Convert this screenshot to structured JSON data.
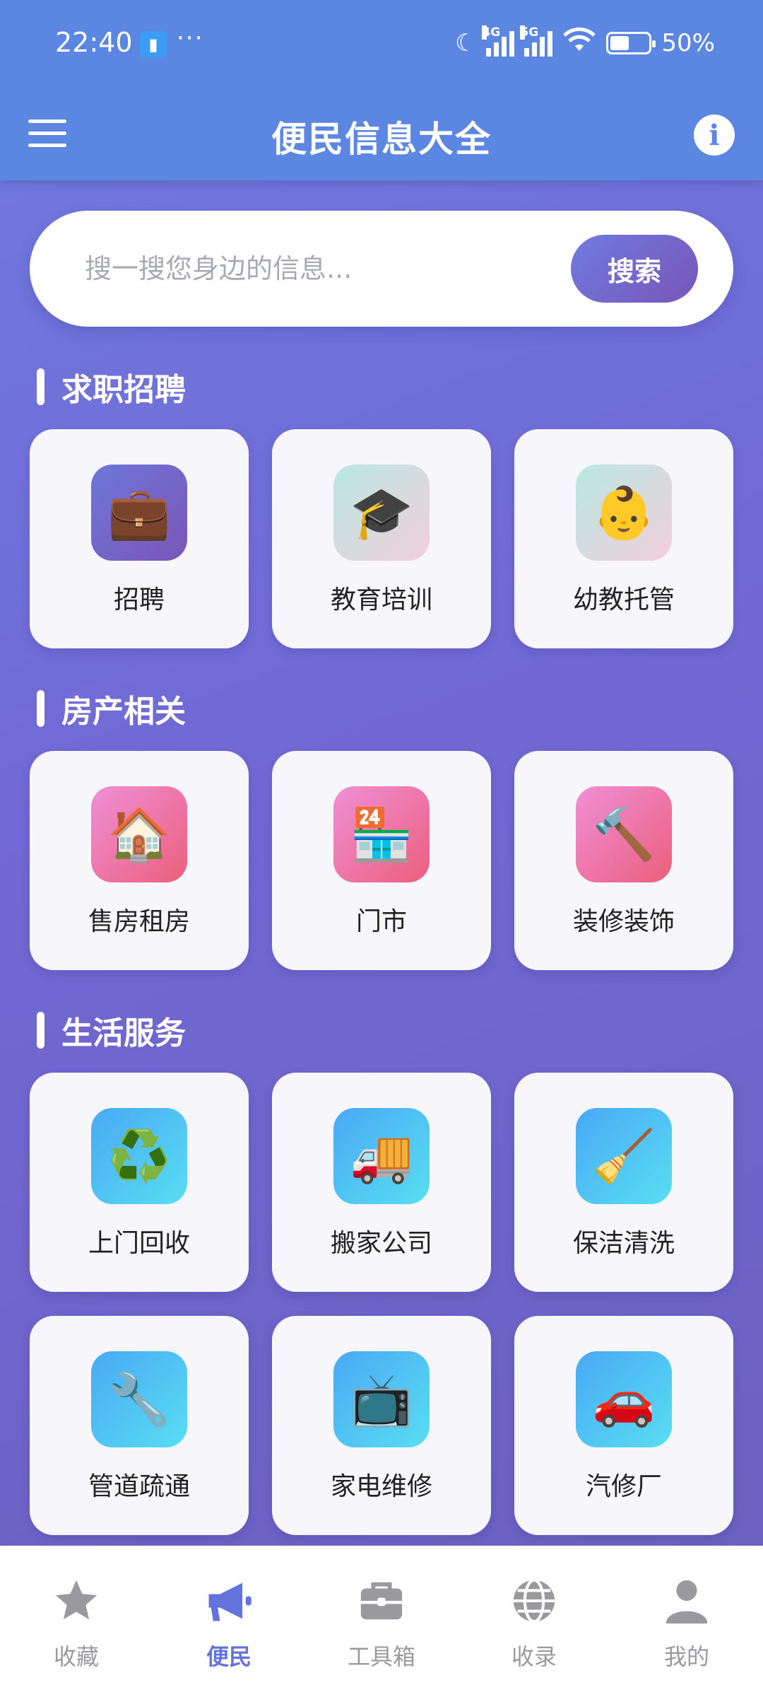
{
  "status_bar": {
    "time": "22:40",
    "network_1": "4G",
    "network_2": "5G",
    "battery_text": "50%",
    "battery_level": 0.5
  },
  "app_bar": {
    "title": "便民信息大全",
    "menu_icon": "hamburger-menu-icon",
    "info_icon": "info-icon"
  },
  "search": {
    "placeholder": "搜一搜您身边的信息...",
    "button_label": "搜索"
  },
  "sections": [
    {
      "title": "求职招聘",
      "items": [
        {
          "label": "招聘",
          "icon": "briefcase-icon",
          "glyph": "💼",
          "style": "purple"
        },
        {
          "label": "教育培训",
          "icon": "graduation-cap-icon",
          "glyph": "🎓",
          "style": "mint"
        },
        {
          "label": "幼教托管",
          "icon": "baby-icon",
          "glyph": "👶",
          "style": "mint"
        }
      ]
    },
    {
      "title": "房产相关",
      "items": [
        {
          "label": "售房租房",
          "icon": "house-icon",
          "glyph": "🏠",
          "style": "pink"
        },
        {
          "label": "门市",
          "icon": "convenience-store-icon",
          "glyph": "🏪",
          "style": "pink"
        },
        {
          "label": "装修装饰",
          "icon": "hammer-icon",
          "glyph": "🔨",
          "style": "pink"
        }
      ]
    },
    {
      "title": "生活服务",
      "items": [
        {
          "label": "上门回收",
          "icon": "recycle-icon",
          "glyph": "♻️",
          "style": "blue"
        },
        {
          "label": "搬家公司",
          "icon": "delivery-truck-icon",
          "glyph": "🚚",
          "style": "blue"
        },
        {
          "label": "保洁清洗",
          "icon": "broom-icon",
          "glyph": "🧹",
          "style": "blue"
        },
        {
          "label": "管道疏通",
          "icon": "wrench-icon",
          "glyph": "🔧",
          "style": "blue"
        },
        {
          "label": "家电维修",
          "icon": "television-icon",
          "glyph": "📺",
          "style": "blue"
        },
        {
          "label": "汽修厂",
          "icon": "car-icon",
          "glyph": "🚗",
          "style": "blue"
        }
      ]
    }
  ],
  "bottom_nav": [
    {
      "label": "收藏",
      "icon": "star-icon",
      "active": false
    },
    {
      "label": "便民",
      "icon": "megaphone-icon",
      "active": true
    },
    {
      "label": "工具箱",
      "icon": "toolbox-icon",
      "active": false
    },
    {
      "label": "收录",
      "icon": "globe-icon",
      "active": false
    },
    {
      "label": "我的",
      "icon": "user-icon",
      "active": false
    }
  ],
  "colors": {
    "app_bar": "#5b87e3",
    "accent": "#6473dc",
    "nav_inactive": "#9a9a9e"
  }
}
